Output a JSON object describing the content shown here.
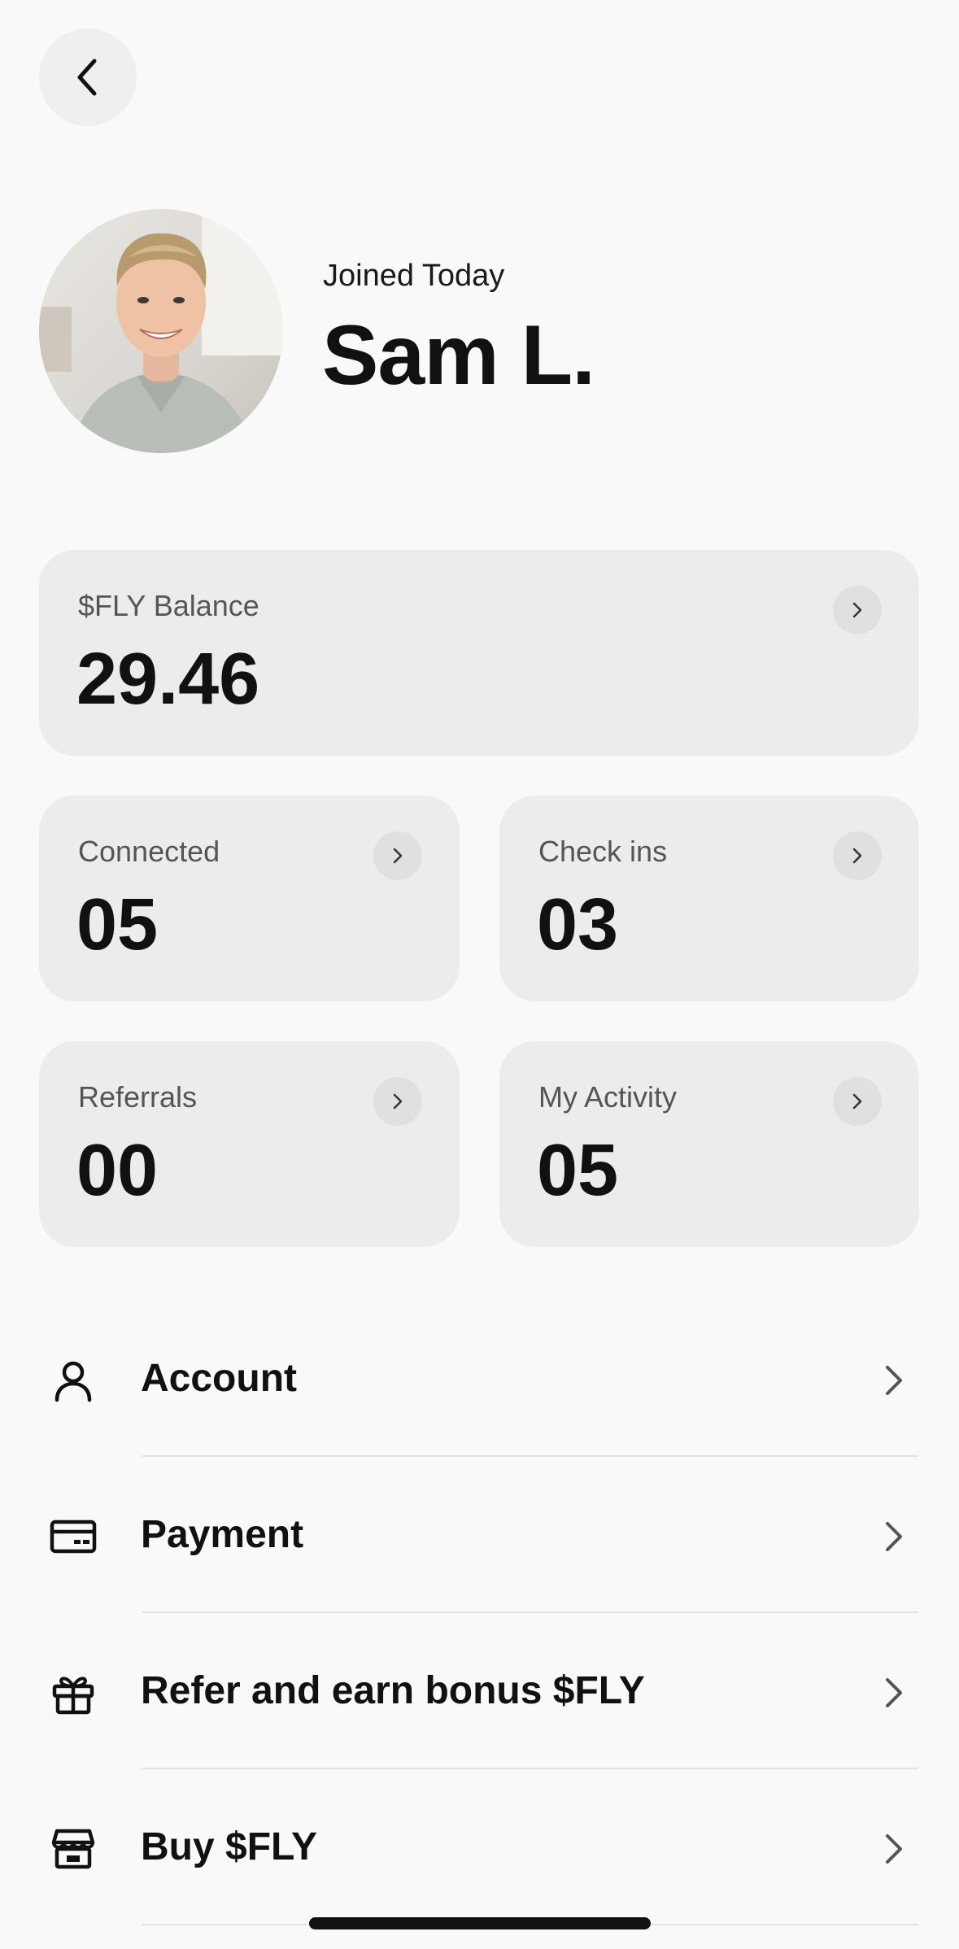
{
  "profile": {
    "joined_text": "Joined Today",
    "name": "Sam L."
  },
  "stats": {
    "balance": {
      "label": "$FLY Balance",
      "value": "29.46"
    },
    "connected": {
      "label": "Connected",
      "value": "05"
    },
    "checkins": {
      "label": "Check ins",
      "value": "03"
    },
    "referrals": {
      "label": "Referrals",
      "value": "00"
    },
    "activity": {
      "label": "My Activity",
      "value": "05"
    }
  },
  "menu": [
    {
      "label": "Account",
      "icon": "user-icon"
    },
    {
      "label": "Payment",
      "icon": "card-icon"
    },
    {
      "label": "Refer and earn bonus $FLY",
      "icon": "gift-icon"
    },
    {
      "label": "Buy $FLY",
      "icon": "store-icon"
    }
  ],
  "colors": {
    "background": "#f9f9f9",
    "card": "#ececec",
    "text": "#111111"
  }
}
